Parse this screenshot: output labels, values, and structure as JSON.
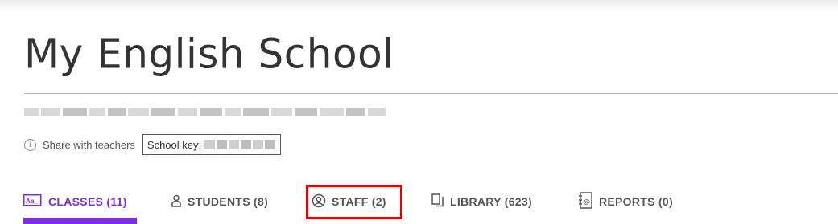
{
  "school": {
    "title": "My English School"
  },
  "share": {
    "info_glyph": "i",
    "label": "Share with teachers",
    "key_label": "School key:"
  },
  "tabs": [
    {
      "label": "CLASSES (11)",
      "icon": "classes-icon",
      "active": true
    },
    {
      "label": "STUDENTS (8)",
      "icon": "student-icon",
      "active": false
    },
    {
      "label": "STAFF (2)",
      "icon": "staff-icon",
      "active": false
    },
    {
      "label": "LIBRARY (623)",
      "icon": "library-icon",
      "active": false
    },
    {
      "label": "REPORTS (0)",
      "icon": "reports-icon",
      "active": false
    }
  ],
  "colors": {
    "accent": "#7b2de8",
    "highlight": "#ee0000",
    "text": "#555555"
  }
}
